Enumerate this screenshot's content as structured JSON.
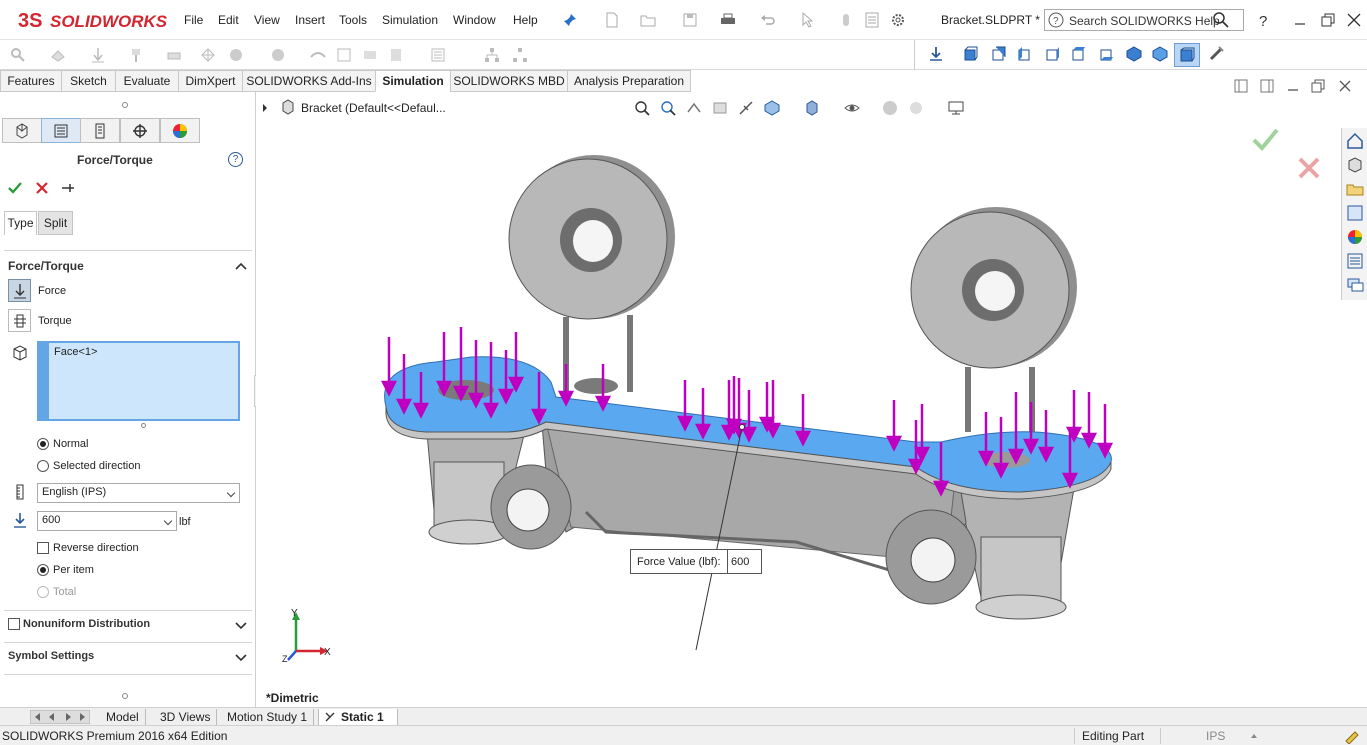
{
  "app": {
    "logo_text": "SOLIDWORKS",
    "document_title": "Bracket.SLDPRT *",
    "search_placeholder": "Search SOLIDWORKS Help"
  },
  "menu": {
    "items": [
      "File",
      "Edit",
      "View",
      "Insert",
      "Tools",
      "Simulation",
      "Window",
      "Help"
    ]
  },
  "command_tabs": [
    {
      "label": "Features"
    },
    {
      "label": "Sketch"
    },
    {
      "label": "Evaluate"
    },
    {
      "label": "DimXpert"
    },
    {
      "label": "SOLIDWORKS Add-Ins"
    },
    {
      "label": "Simulation",
      "active": true
    },
    {
      "label": "SOLIDWORKS MBD"
    },
    {
      "label": "Analysis Preparation"
    }
  ],
  "property_manager": {
    "title": "Force/Torque",
    "help_label": "?",
    "subtabs": [
      "Type",
      "Split"
    ],
    "section_force_torque": "Force/Torque",
    "force_label": "Force",
    "torque_label": "Torque",
    "selection_item": "Face<1>",
    "direction_normal": "Normal",
    "direction_selected": "Selected direction",
    "unit_system": "English (IPS)",
    "force_value": "600",
    "force_unit": "lbf",
    "reverse_direction": "Reverse direction",
    "per_item": "Per item",
    "total": "Total",
    "nonuniform": "Nonuniform Distribution",
    "symbol_settings": "Symbol Settings"
  },
  "graphics": {
    "tree_item": "Bracket  (Default<<Defaul...",
    "callout_label": "Force Value (lbf):",
    "callout_value": "600",
    "view_name": "*Dimetric",
    "triad_x": "X",
    "triad_y": "Y",
    "triad_z": "Z"
  },
  "bottom_tabs": [
    {
      "label": "Model"
    },
    {
      "label": "3D Views"
    },
    {
      "label": "Motion Study 1"
    },
    {
      "label": "Static 1",
      "active": true
    }
  ],
  "status": {
    "edition": "SOLIDWORKS Premium 2016 x64 Edition",
    "mode": "Editing Part",
    "units": "IPS"
  },
  "colors": {
    "accent_red": "#d22630",
    "selected_face": "#5aa8ef",
    "force_arrow": "#c000c0",
    "part_gray": "#a9a9a9",
    "selection_box": "#cde6fb"
  }
}
